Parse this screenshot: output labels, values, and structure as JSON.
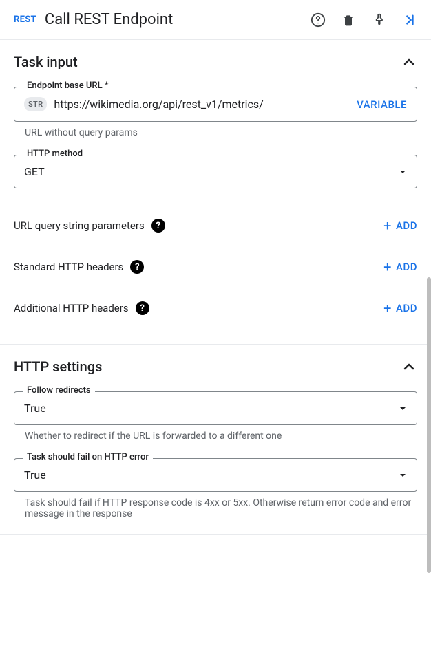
{
  "header": {
    "badge": "REST",
    "title": "Call REST Endpoint"
  },
  "sections": {
    "task_input": {
      "title": "Task input",
      "endpoint": {
        "label": "Endpoint base URL *",
        "type_badge": "STR",
        "value": "https://wikimedia.org/api/rest_v1/metrics/",
        "variable_label": "VARIABLE",
        "helper": "URL without query params"
      },
      "http_method": {
        "label": "HTTP method",
        "value": "GET"
      },
      "params": {
        "query_string": {
          "label": "URL query string parameters",
          "add_label": "ADD"
        },
        "standard_headers": {
          "label": "Standard HTTP headers",
          "add_label": "ADD"
        },
        "additional_headers": {
          "label": "Additional HTTP headers",
          "add_label": "ADD"
        }
      }
    },
    "http_settings": {
      "title": "HTTP settings",
      "follow_redirects": {
        "label": "Follow redirects",
        "value": "True",
        "helper": "Whether to redirect if the URL is forwarded to a different one"
      },
      "fail_on_error": {
        "label": "Task should fail on HTTP error",
        "value": "True",
        "helper": "Task should fail if HTTP response code is 4xx or 5xx. Otherwise return error code and error message in the response"
      }
    }
  }
}
